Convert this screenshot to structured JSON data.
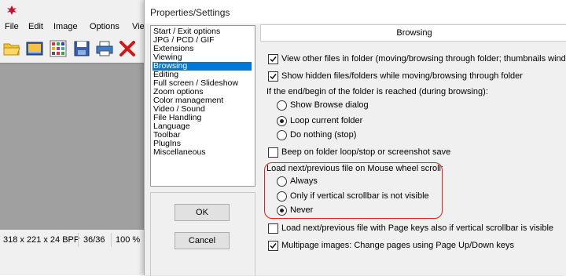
{
  "main_window": {
    "menu": [
      "File",
      "Edit",
      "Image",
      "Options",
      "Vie"
    ],
    "toolbar_icons": [
      "open-folder-icon",
      "slideshow-icon",
      "thumbnails-icon",
      "save-icon",
      "print-icon",
      "delete-icon"
    ],
    "status": {
      "dimensions": "318 x 221 x 24 BPP",
      "position": "36/36",
      "zoom": "100 %"
    }
  },
  "dialog": {
    "title": "Properties/Settings",
    "categories": [
      {
        "label": "Start / Exit options",
        "selected": false
      },
      {
        "label": "JPG / PCD / GIF",
        "selected": false
      },
      {
        "label": "Extensions",
        "selected": false
      },
      {
        "label": "Viewing",
        "selected": false
      },
      {
        "label": "Browsing",
        "selected": true
      },
      {
        "label": "Editing",
        "selected": false
      },
      {
        "label": "Full screen / Slideshow",
        "selected": false
      },
      {
        "label": "Zoom options",
        "selected": false
      },
      {
        "label": "Color management",
        "selected": false
      },
      {
        "label": "Video / Sound",
        "selected": false
      },
      {
        "label": "File Handling",
        "selected": false
      },
      {
        "label": "Language",
        "selected": false
      },
      {
        "label": "Toolbar",
        "selected": false
      },
      {
        "label": "PlugIns",
        "selected": false
      },
      {
        "label": "Miscellaneous",
        "selected": false
      }
    ],
    "ok_label": "OK",
    "cancel_label": "Cancel",
    "section_header": "Browsing",
    "options": {
      "view_other_files": {
        "label": "View other files in folder (moving/browsing through folder; thumbnails window)",
        "checked": true
      },
      "show_hidden": {
        "label": "Show hidden files/folders while moving/browsing through folder",
        "checked": true
      },
      "end_folder_caption": "If the end/begin of the folder is reached (during browsing):",
      "end_folder_choices": [
        {
          "label": "Show Browse dialog",
          "selected": false
        },
        {
          "label": "Loop current folder",
          "selected": true
        },
        {
          "label": "Do nothing (stop)",
          "selected": false
        }
      ],
      "beep": {
        "label": "Beep on folder loop/stop or screenshot save",
        "checked": false
      },
      "wheel_caption": "Load next/previous file on Mouse wheel scroll:",
      "wheel_choices": [
        {
          "label": "Always",
          "selected": false
        },
        {
          "label": "Only if vertical scrollbar is not visible",
          "selected": false
        },
        {
          "label": "Never",
          "selected": true
        }
      ],
      "page_keys": {
        "label": "Load next/previous file with Page keys also if vertical scrollbar is visible",
        "checked": false
      },
      "multipage": {
        "label": "Multipage images: Change pages using Page Up/Down keys",
        "checked": true
      }
    }
  },
  "colors": {
    "selection": "#0078d7",
    "highlight_border": "#e02020"
  }
}
